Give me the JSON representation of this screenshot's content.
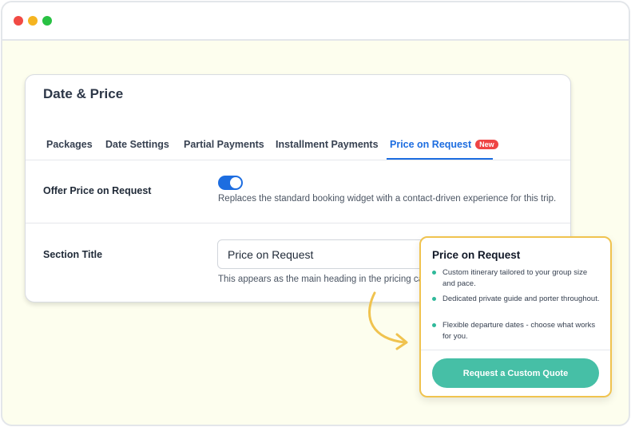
{
  "window": {
    "controls": [
      "close",
      "minimize",
      "maximize"
    ]
  },
  "card": {
    "title": "Date & Price",
    "tabs": [
      {
        "label": "Packages"
      },
      {
        "label": "Date Settings"
      },
      {
        "label": "Partial Payments"
      },
      {
        "label": "Installment Payments"
      },
      {
        "label": "Price on Request",
        "badge": "New",
        "active": true
      }
    ],
    "offer_label": "Offer Price on Request",
    "offer_toggle_on": true,
    "offer_help": "Replaces the standard booking widget with a contact-driven experience for this trip.",
    "section_title_label": "Section Title",
    "section_title_value": "Price on Request",
    "section_title_help": "This appears as the main heading in the pricing card."
  },
  "preview": {
    "title": "Price on Request",
    "features": [
      "Custom itinerary tailored to your group size and pace.",
      "Dedicated private guide and porter throughout.",
      "Flexible departure dates - choose what works for you."
    ],
    "cta_label": "Request a Custom Quote"
  },
  "colors": {
    "accent": "#1d6de0",
    "badge": "#ef4444",
    "cta": "#46bfa6",
    "highlight_border": "#f0c34f",
    "arrow": "#f0c34f",
    "background": "#fdfeee"
  }
}
